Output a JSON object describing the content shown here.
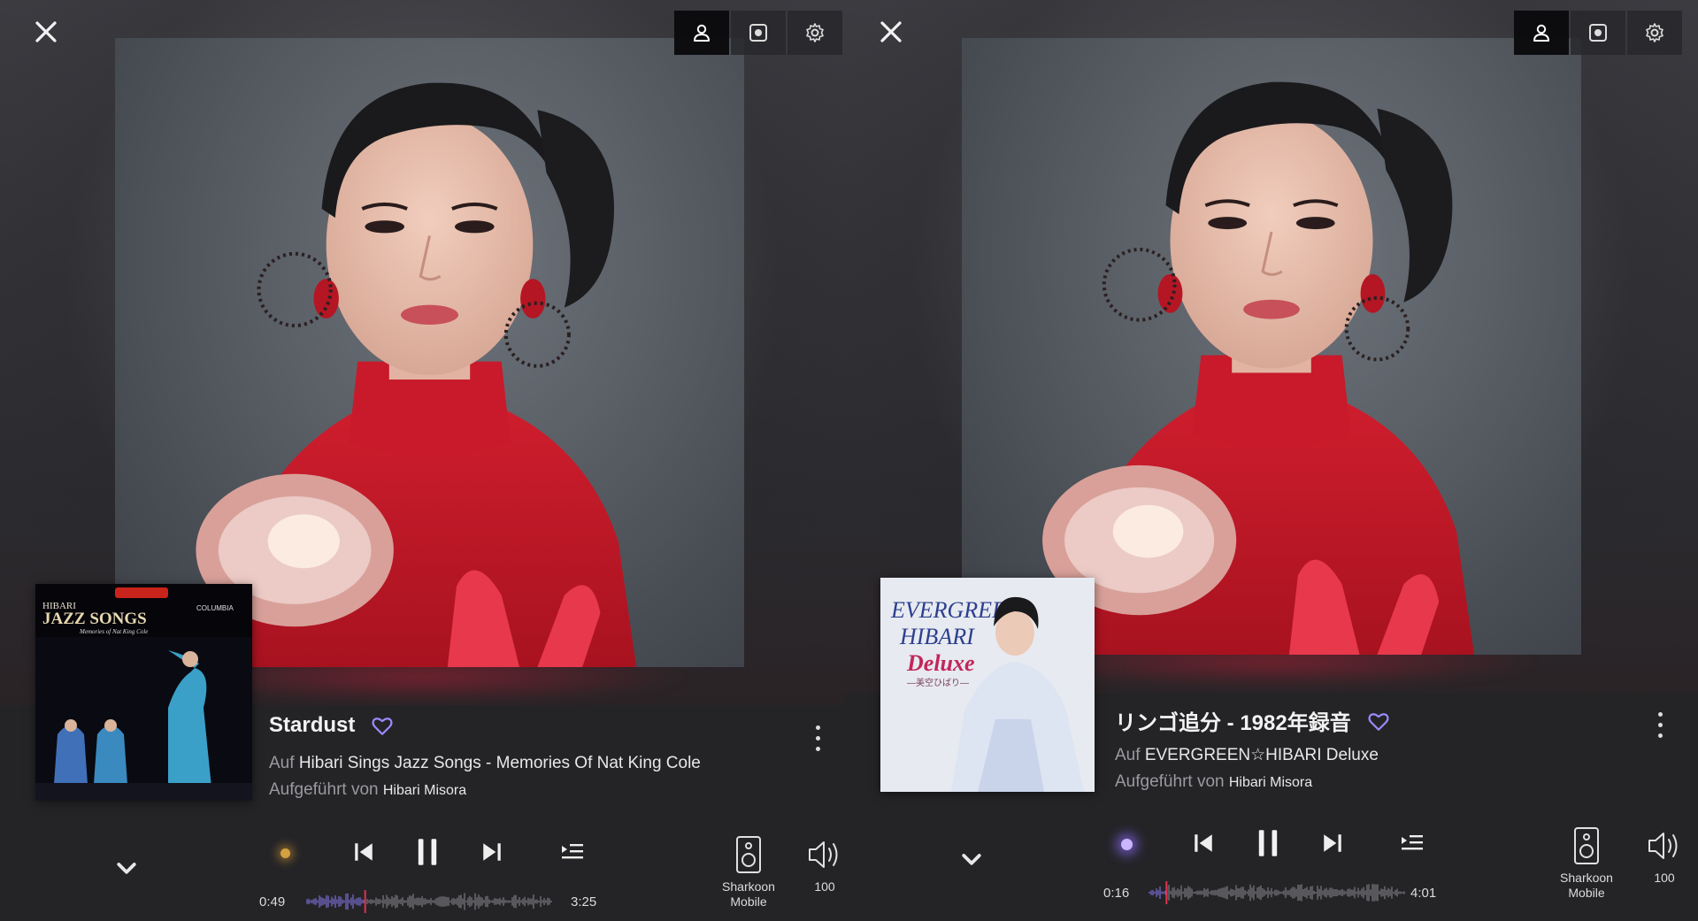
{
  "panels": [
    {
      "track_title": "Stardust",
      "on_prefix": "Auf",
      "album": "Hibari Sings Jazz Songs - Memories Of Nat King Cole",
      "performed_prefix": "Aufgeführt von",
      "artist": "Hibari Misora",
      "elapsed": "0:49",
      "duration": "3:25",
      "progress": 0.24,
      "device_label_1": "Sharkoon",
      "device_label_2": "Mobile",
      "volume": "100",
      "cover_text": {
        "line1": "HIBARI",
        "line2": "JAZZ SONGS",
        "line3": "Memories of Nat King Cole",
        "label": "COLUMBIA"
      },
      "indicator_color": "#d4a040"
    },
    {
      "track_title": "リンゴ追分 - 1982年録音",
      "on_prefix": "Auf",
      "album": "EVERGREEN☆HIBARI Deluxe",
      "performed_prefix": "Aufgeführt von",
      "artist": "Hibari Misora",
      "elapsed": "0:16",
      "duration": "4:01",
      "progress": 0.07,
      "device_label_1": "Sharkoon",
      "device_label_2": "Mobile",
      "volume": "100",
      "cover_text": {
        "line1": "EVERGREEN",
        "line2": "HIBARI",
        "line3": "Deluxe",
        "line4": "―美空ひばり―"
      },
      "indicator_color": "#c9b6ff"
    }
  ],
  "icons": {
    "close": "close-icon",
    "artist": "user-icon",
    "display": "screen-icon",
    "settings": "gear-icon",
    "favorite": "heart-icon",
    "more": "more-vertical-icon",
    "collapse": "chevron-down-icon",
    "previous": "skip-previous-icon",
    "pause": "pause-icon",
    "next": "skip-next-icon",
    "queue": "queue-icon",
    "speaker": "speaker-icon",
    "volume": "volume-icon"
  },
  "colors": {
    "accent": "#8b7cf6",
    "playhead": "#e0314b",
    "background": "#242427"
  }
}
